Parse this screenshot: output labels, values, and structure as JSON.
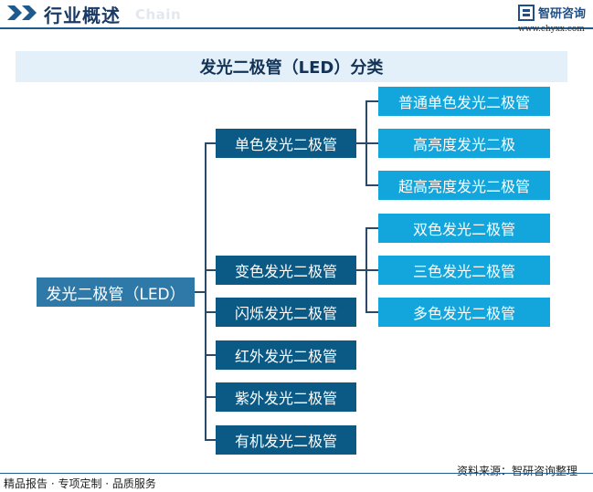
{
  "header": {
    "title": "行业概述",
    "subtitle": "Chain",
    "logo_text": "智研咨询",
    "logo_url": "www.chyxx.com",
    "accent_color": "#1f5a8c"
  },
  "diagram": {
    "title": "发光二极管（LED）分类",
    "root": "发光二极管（LED）",
    "groups": [
      {
        "label": "单色发光二极管",
        "children": [
          "普通单色发光二极管",
          "高亮度发光二极",
          "超高亮度发光二极管"
        ]
      },
      {
        "label": "变色发光二极管",
        "children": [
          "双色发光二极管",
          "三色发光二极管",
          "多色发光二极管"
        ]
      },
      {
        "label": "闪烁发光二极管",
        "children": []
      },
      {
        "label": "红外发光二极管",
        "children": []
      },
      {
        "label": "紫外发光二极管",
        "children": []
      },
      {
        "label": "有机发光二极管",
        "children": []
      }
    ],
    "colors": {
      "root": "#2f79a8",
      "mid": "#0b5a85",
      "leaf": "#13a6dc",
      "title_bg": "#e3eff9"
    }
  },
  "footer": {
    "left": "精品报告 · 专项定制 · 品质服务",
    "source": "资料来源：智研咨询整理"
  }
}
